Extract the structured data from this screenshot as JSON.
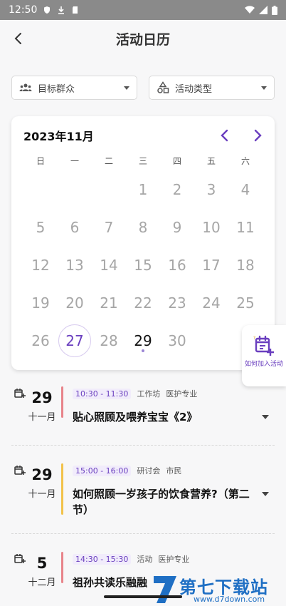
{
  "status_bar": {
    "time": "12:50"
  },
  "header": {
    "title": "活动日历"
  },
  "filters": [
    {
      "label": "目标群众"
    },
    {
      "label": "活动类型"
    }
  ],
  "calendar": {
    "title": "2023年11月",
    "weekdays": [
      "日",
      "一",
      "二",
      "三",
      "四",
      "五",
      "六"
    ],
    "days": [
      "",
      "",
      "",
      "1",
      "2",
      "3",
      "4",
      "5",
      "6",
      "7",
      "8",
      "9",
      "10",
      "11",
      "12",
      "13",
      "14",
      "15",
      "16",
      "17",
      "18",
      "19",
      "20",
      "21",
      "22",
      "23",
      "24",
      "25",
      "26",
      "27",
      "28",
      "29",
      "30",
      "",
      ""
    ],
    "selected_day": "27",
    "today": "29",
    "colors": {
      "accent": "#6a3fbf"
    }
  },
  "fab": {
    "label": "如何加入活动"
  },
  "events": [
    {
      "day": "29",
      "month": "十一月",
      "time": "10:30 - 11:30",
      "type": "工作坊",
      "audience": "医护专业",
      "title": "贴心照顾及喂养宝宝《2》",
      "bar_color": "#e8848a"
    },
    {
      "day": "29",
      "month": "十一月",
      "time": "15:00 - 16:00",
      "type": "研讨会",
      "audience": "市民",
      "title": "如何照顾一岁孩子的饮食营养?（第二节）",
      "bar_color": "#f2c24a"
    },
    {
      "day": "5",
      "month": "十二月",
      "time": "14:30 - 15:30",
      "type": "活动",
      "audience": "医护专业",
      "title": "祖孙共读乐融融",
      "bar_color": "#e8848a"
    }
  ],
  "watermark": {
    "text": "第七下载站",
    "url": "www.d7down.com"
  }
}
